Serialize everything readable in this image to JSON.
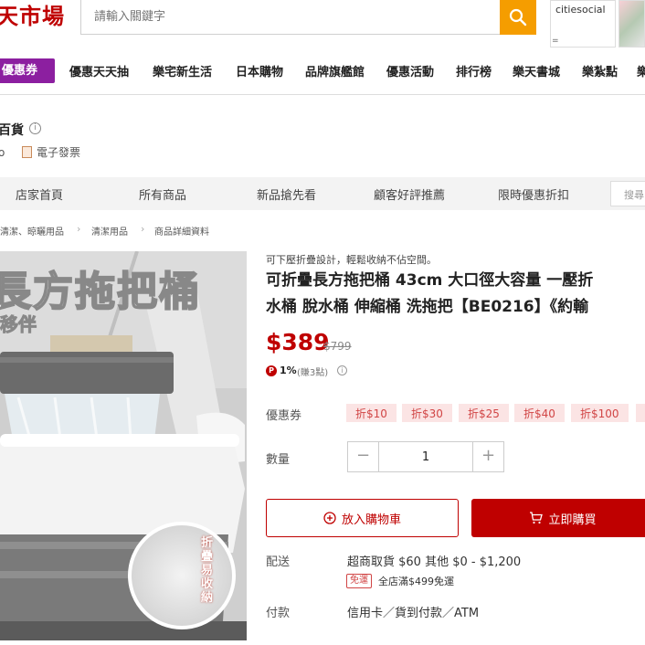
{
  "header": {
    "logo": "天市場",
    "search_placeholder": "請輸入關鍵字",
    "ad_label": "citiesocial",
    "ad_sub": "="
  },
  "nav": {
    "coupon": "優惠券",
    "items": [
      "優惠天天抽",
      "樂宅新生活",
      "日本購物",
      "品牌旗艦館",
      "優惠活動",
      "排行榜",
      "樂天書城",
      "樂紮點",
      "樂"
    ]
  },
  "shop": {
    "name": "百貨",
    "dot": "o",
    "invoice": "電子發票"
  },
  "shop_tabs": [
    "店家首頁",
    "所有商品",
    "新品搶先看",
    "顧客好評推薦",
    "限時優惠折扣"
  ],
  "shop_search_placeholder": "搜尋",
  "breadcrumb": [
    "清潔、晾曬用品",
    "清潔用品",
    "商品詳細資料"
  ],
  "product_image": {
    "title_overlay": "長方拖把桶",
    "sub_overlay": "移伴",
    "fold_label": "折疊易收納"
  },
  "product": {
    "promo": "可下壓折疊設計，輕鬆收納不佔空間。",
    "title_line1": "可折疊長方拖把桶 43cm 大口徑大容量 一壓折",
    "title_line2": "水桶 脫水桶 伸縮桶 洗拖把【BE0216】《約輸",
    "price": "$389",
    "original_price": "$799",
    "points_icon": "P",
    "points_pct": "1%",
    "points_earn": "(賺3點)",
    "points_info": "i"
  },
  "coupons": {
    "label": "優惠券",
    "chips": [
      "折$10",
      "折$30",
      "折$25",
      "折$40",
      "折$100",
      "折"
    ]
  },
  "quantity": {
    "label": "數量",
    "minus": "−",
    "value": "1",
    "plus": "+"
  },
  "buttons": {
    "cart": "放入購物車",
    "buy": "立即購買"
  },
  "shipping": {
    "label": "配送",
    "main": "超商取貨 $60    其他 $0 - $1,200",
    "free_tag": "免運",
    "free_text": "全店滿$499免運"
  },
  "payment": {
    "label": "付款",
    "methods": "信用卡／貨到付款／ATM"
  },
  "colors": {
    "brand_red": "#bf0000",
    "search_orange": "#f59d00",
    "coupon_purple": "#8c1fa0"
  }
}
